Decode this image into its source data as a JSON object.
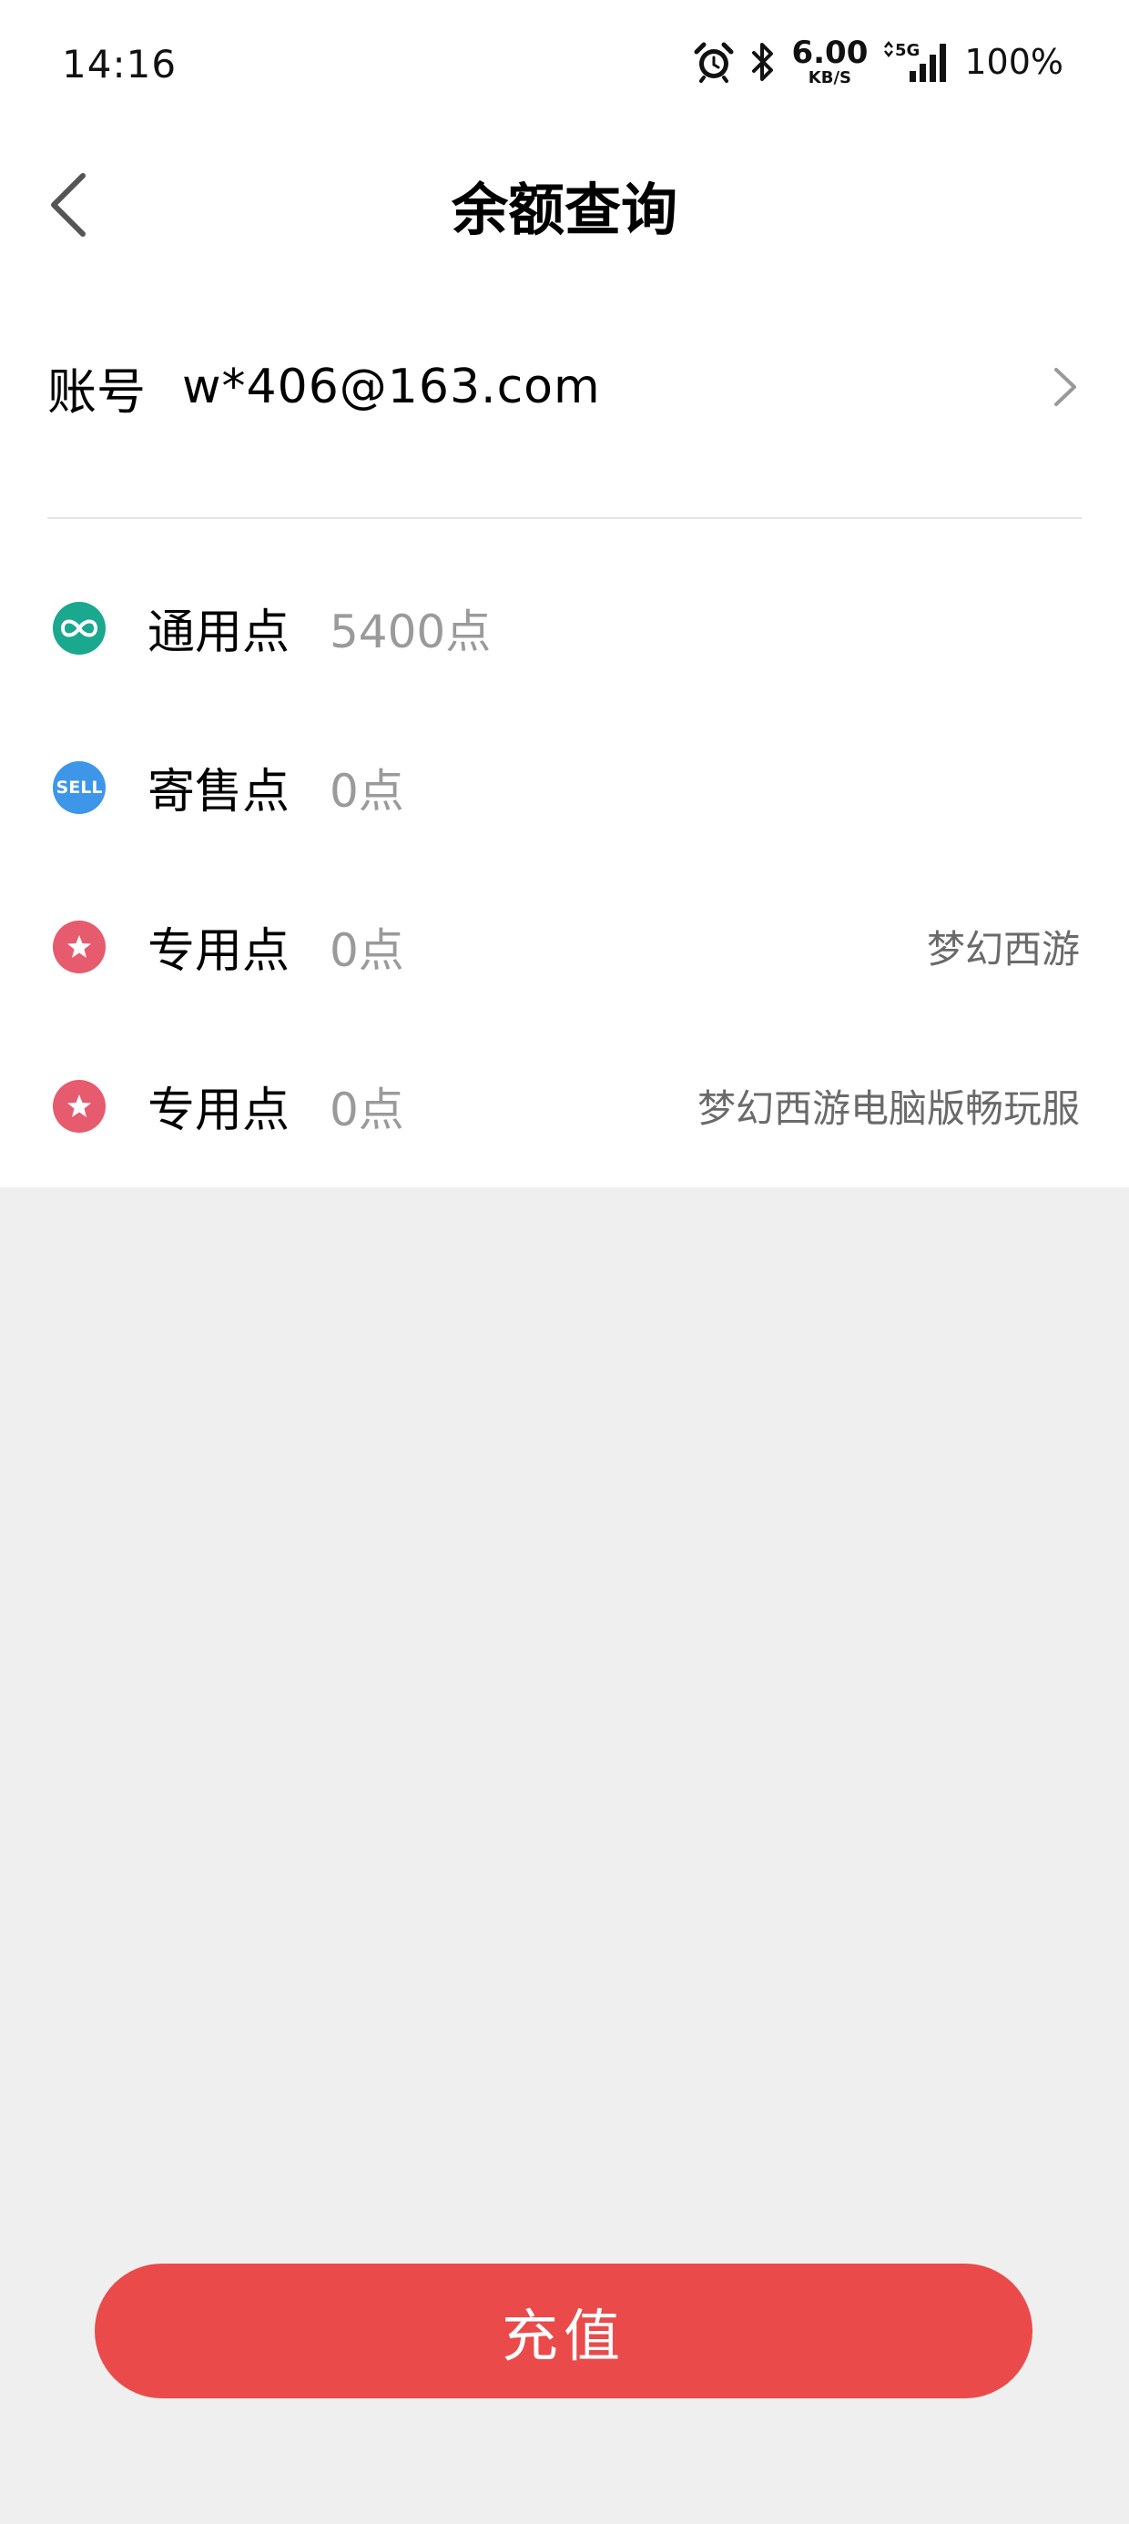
{
  "status_bar": {
    "time": "14:16",
    "net_speed_value": "6.00",
    "net_speed_unit": "KB/S",
    "network_type": "5G",
    "battery": "100%"
  },
  "header": {
    "title": "余额查询"
  },
  "account": {
    "label": "账号",
    "value": "w*406@163.com"
  },
  "points": [
    {
      "label": "通用点",
      "value": "5400点",
      "note": "",
      "icon": "infinity-icon",
      "color": "#1aa88f"
    },
    {
      "label": "寄售点",
      "value": "0点",
      "note": "",
      "icon": "sell-icon",
      "icon_text": "SELL",
      "color": "#3d96e8"
    },
    {
      "label": "专用点",
      "value": "0点",
      "note": "梦幻西游",
      "icon": "star-icon",
      "color": "#e65b6e"
    },
    {
      "label": "专用点",
      "value": "0点",
      "note": "梦幻西游电脑版畅玩服",
      "icon": "star-icon",
      "color": "#e65b6e"
    }
  ],
  "recharge_button": {
    "label": "充值",
    "color": "#ea4a4a"
  }
}
